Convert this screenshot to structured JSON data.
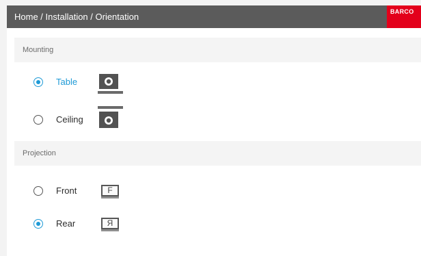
{
  "header": {
    "breadcrumb": "Home / Installation / Orientation",
    "logo_text": "BARCO",
    "colors": {
      "bar": "#5b5b5b",
      "logo": "#e3001b"
    }
  },
  "accent_color": "#1e9ad6",
  "mounting": {
    "title": "Mounting",
    "options": [
      {
        "label": "Table",
        "icon": "table-mount-icon",
        "checked": true
      },
      {
        "label": "Ceiling",
        "icon": "ceiling-mount-icon",
        "checked": false
      }
    ]
  },
  "projection": {
    "title": "Projection",
    "options": [
      {
        "label": "Front",
        "icon": "front-projection-icon",
        "icon_text": "F",
        "checked": false
      },
      {
        "label": "Rear",
        "icon": "rear-projection-icon",
        "icon_text": "Я",
        "checked": true
      }
    ]
  }
}
